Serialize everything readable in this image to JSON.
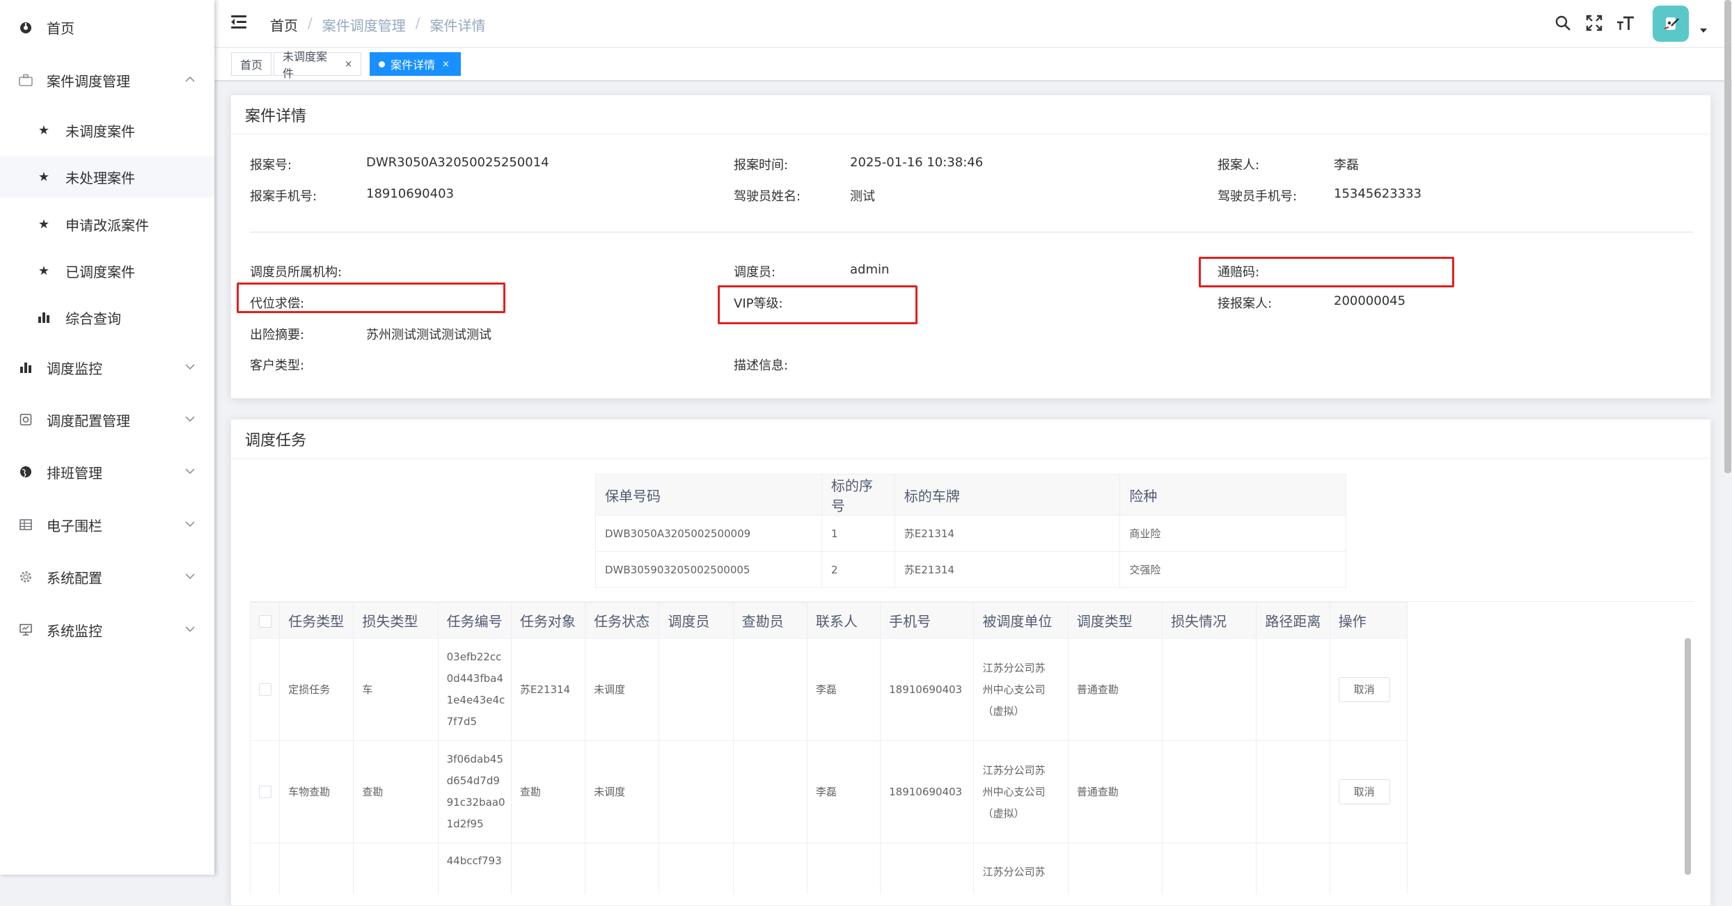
{
  "sidebar": {
    "items": [
      {
        "label": "首页"
      },
      {
        "label": "案件调度管理"
      },
      {
        "label": "未调度案件"
      },
      {
        "label": "未处理案件"
      },
      {
        "label": "申请改派案件"
      },
      {
        "label": "已调度案件"
      },
      {
        "label": "综合查询"
      },
      {
        "label": "调度监控"
      },
      {
        "label": "调度配置管理"
      },
      {
        "label": "排班管理"
      },
      {
        "label": "电子围栏"
      },
      {
        "label": "系统配置"
      },
      {
        "label": "系统监控"
      }
    ]
  },
  "header": {
    "breadcrumb": [
      "首页",
      "案件调度管理",
      "案件详情"
    ],
    "separator": "/"
  },
  "tags": [
    {
      "label": "首页"
    },
    {
      "label": "未调度案件",
      "close": "×"
    },
    {
      "label": "案件详情",
      "close": "×"
    }
  ],
  "detail": {
    "title": "案件详情",
    "fields": {
      "report_no": {
        "label": "报案号:",
        "value": "DWR3050A32050025250014"
      },
      "report_time": {
        "label": "报案时间:",
        "value": "2025-01-16 10:38:46"
      },
      "reporter": {
        "label": "报案人:",
        "value": "李磊"
      },
      "reporter_phone": {
        "label": "报案手机号:",
        "value": "18910690403"
      },
      "driver_name": {
        "label": "驾驶员姓名:",
        "value": "测试"
      },
      "driver_phone": {
        "label": "驾驶员手机号:",
        "value": "15345623333"
      },
      "dispatcher_org": {
        "label": "调度员所属机构:",
        "value": ""
      },
      "dispatcher": {
        "label": "调度员:",
        "value": "admin"
      },
      "tongpei_code": {
        "label": "通赔码:",
        "value": ""
      },
      "subrogation": {
        "label": "代位求偿:",
        "value": ""
      },
      "vip_level": {
        "label": "VIP等级:",
        "value": ""
      },
      "receiver": {
        "label": "接报案人:",
        "value": "200000045"
      },
      "accident_summary": {
        "label": "出险摘要:",
        "value": "苏州测试测试测试测试"
      },
      "customer_type": {
        "label": "客户类型:",
        "value": ""
      },
      "description": {
        "label": "描述信息:",
        "value": ""
      }
    }
  },
  "tasks": {
    "title": "调度任务",
    "policy_table": {
      "columns": [
        "保单号码",
        "标的序号",
        "标的车牌",
        "险种"
      ],
      "rows": [
        [
          "DWB3050A3205002500009",
          "1",
          "苏E21314",
          "商业险"
        ],
        [
          "DWB305903205002500005",
          "2",
          "苏E21314",
          "交强险"
        ]
      ]
    },
    "task_table": {
      "columns": [
        "",
        "任务类型",
        "损失类型",
        "任务编号",
        "任务对象",
        "任务状态",
        "调度员",
        "查勘员",
        "联系人",
        "手机号",
        "被调度单位",
        "调度类型",
        "损失情况",
        "路径距离",
        "操作"
      ],
      "rows": [
        {
          "type": "定损任务",
          "loss": "车",
          "no_lines": [
            "03efb22cc",
            "0d443fba4",
            "1e4e43e4c",
            "7f7d5"
          ],
          "object": "苏E21314",
          "status": "未调度",
          "dispatcher": "",
          "surveyor": "",
          "contact": "李磊",
          "phone": "18910690403",
          "unit_lines": [
            "江苏分公司苏",
            "州中心支公司",
            "（虚拟）"
          ],
          "dispatch_type": "普通查勘",
          "loss_status": "",
          "distance": "",
          "action": "取消"
        },
        {
          "type": "车物查勘",
          "loss": "查勘",
          "no_lines": [
            "3f06dab45",
            "d654d7d9",
            "91c32baa0",
            "1d2f95"
          ],
          "object": "查勘",
          "status": "未调度",
          "dispatcher": "",
          "surveyor": "",
          "contact": "李磊",
          "phone": "18910690403",
          "unit_lines": [
            "江苏分公司苏",
            "州中心支公司",
            "（虚拟）"
          ],
          "dispatch_type": "普通查勘",
          "loss_status": "",
          "distance": "",
          "action": "取消"
        },
        {
          "type": "",
          "loss": "",
          "no_lines": [
            "44bccf793"
          ],
          "object": "",
          "status": "",
          "dispatcher": "",
          "surveyor": "",
          "contact": "",
          "phone": "",
          "unit_lines": [
            "江苏分公司苏"
          ],
          "dispatch_type": "",
          "loss_status": "",
          "distance": "",
          "action": ""
        }
      ]
    }
  },
  "colors": {
    "accent": "#1890ff",
    "highlight_box": "#e02020",
    "avatar_bg": "#5ac8c8"
  },
  "icons": {
    "header": [
      "menu-fold-icon",
      "search-icon",
      "fullscreen-icon",
      "font-size-icon",
      "avatar-icon",
      "caret-down-icon"
    ]
  }
}
